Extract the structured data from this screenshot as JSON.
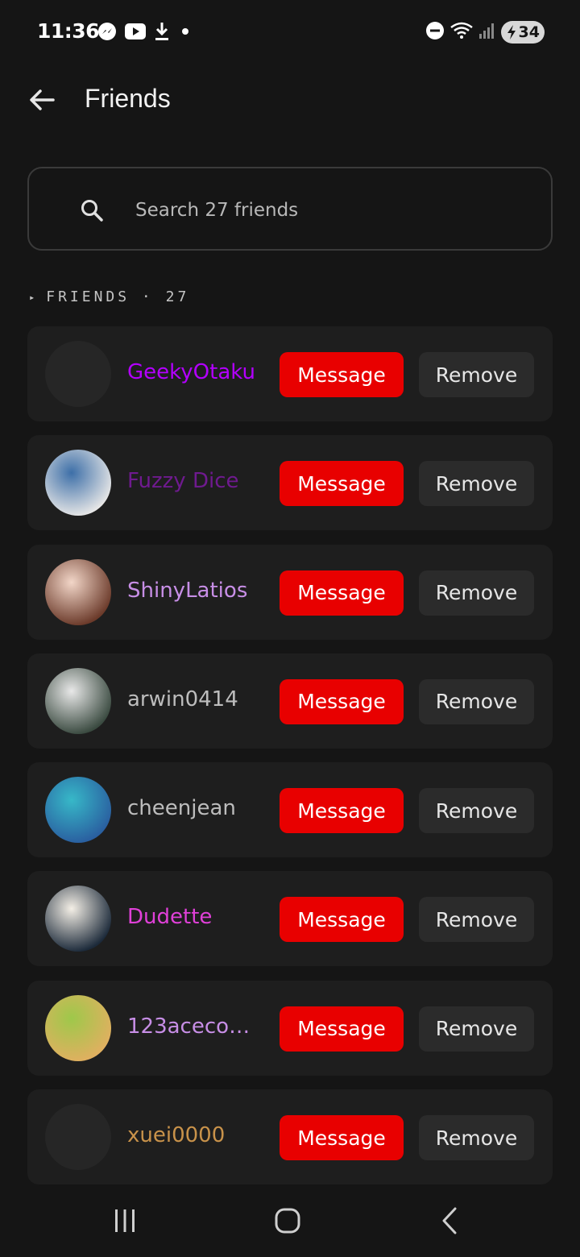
{
  "status_bar": {
    "time": "11:36",
    "battery": "34",
    "icons": [
      "messenger-icon",
      "youtube-icon",
      "download-icon",
      "dot-icon",
      "dnd-icon",
      "wifi-icon",
      "signal-icon",
      "battery-charging-icon"
    ]
  },
  "header": {
    "title": "Friends",
    "back_icon": "arrow-left-icon"
  },
  "search": {
    "placeholder": "Search 27 friends",
    "value": ""
  },
  "section": {
    "caret": "▸",
    "label": "FRIENDS · 27"
  },
  "friends": [
    {
      "name": "GeekyOtaku",
      "color": "#b300ff",
      "avatar": "empty",
      "avatar_colors": [
        "#262626",
        "#262626"
      ]
    },
    {
      "name": "Fuzzy Dice",
      "color": "#6f1a8f",
      "avatar": "image",
      "avatar_colors": [
        "#3d6fa8",
        "#e6e6e6"
      ]
    },
    {
      "name": "ShinyLatios",
      "color": "#c78ee6",
      "avatar": "image",
      "avatar_colors": [
        "#f2d6c8",
        "#6b3a2a"
      ]
    },
    {
      "name": "arwin0414",
      "color": "#bdbdbd",
      "avatar": "image",
      "avatar_colors": [
        "#e8e8e8",
        "#3a4a40"
      ]
    },
    {
      "name": "cheenjean",
      "color": "#bdbdbd",
      "avatar": "image",
      "avatar_colors": [
        "#37b8c8",
        "#2a5fa0"
      ]
    },
    {
      "name": "Dudette",
      "color": "#e040d8",
      "avatar": "image",
      "avatar_colors": [
        "#f4efe6",
        "#1c2a3a"
      ]
    },
    {
      "name": "123acecom...",
      "color": "#c78ee6",
      "avatar": "image",
      "avatar_colors": [
        "#9ec84a",
        "#e0b060"
      ]
    },
    {
      "name": "xuei0000",
      "color": "#c8924a",
      "avatar": "empty",
      "avatar_colors": [
        "#262626",
        "#262626"
      ]
    }
  ],
  "actions": {
    "message_label": "Message",
    "remove_label": "Remove"
  },
  "nav": {
    "recents_icon": "recents-icon",
    "home_icon": "home-icon",
    "back_icon": "back-chevron-icon"
  }
}
